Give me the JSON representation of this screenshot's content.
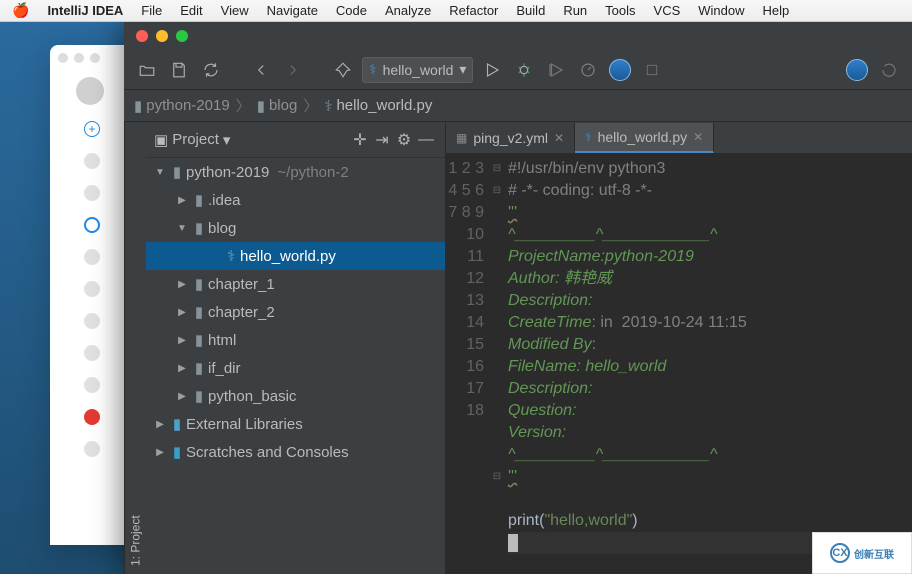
{
  "menubar": {
    "app": "IntelliJ IDEA",
    "items": [
      "File",
      "Edit",
      "View",
      "Navigate",
      "Code",
      "Analyze",
      "Refactor",
      "Build",
      "Run",
      "Tools",
      "VCS",
      "Window",
      "Help"
    ]
  },
  "run_config": {
    "label": "hello_world"
  },
  "breadcrumb": {
    "root": "python-2019",
    "folder": "blog",
    "file": "hello_world.py"
  },
  "project_panel": {
    "title": "Project",
    "side_label": "1: Project",
    "root": {
      "name": "python-2019",
      "path": "~/python-2"
    },
    "nodes": {
      "idea": ".idea",
      "blog": "blog",
      "hello": "hello_world.py",
      "ch1": "chapter_1",
      "ch2": "chapter_2",
      "html": "html",
      "ifdir": "if_dir",
      "pybasic": "python_basic",
      "ext": "External Libraries",
      "scratch": "Scratches and Consoles"
    }
  },
  "tabs": {
    "t1": "ping_v2.yml",
    "t2": "hello_world.py"
  },
  "editor": {
    "l1": "#!/usr/bin/env python3",
    "l2": "# -*- coding: utf-8 -*-",
    "l3": "'''",
    "l4": "^_________^____________^",
    "l5": "ProjectName:python-2019",
    "l6a": "Author:",
    "l6b": " 韩艳威",
    "l7": "Description:",
    "l8a": "CreateTime",
    "l8b": ": in  2019-10-24 11:15",
    "l9a": "Modified By",
    "l9b": ":",
    "l10": "FileName: hello_world",
    "l11": "Description:",
    "l12": "Question:",
    "l13": "Version:",
    "l14": "^_________^____________^",
    "l15": "'''",
    "l17_fn": "print",
    "l17_p1": "(",
    "l17_str": "\"hello,world\"",
    "l17_p2": ")"
  },
  "watermark": "创新互联"
}
